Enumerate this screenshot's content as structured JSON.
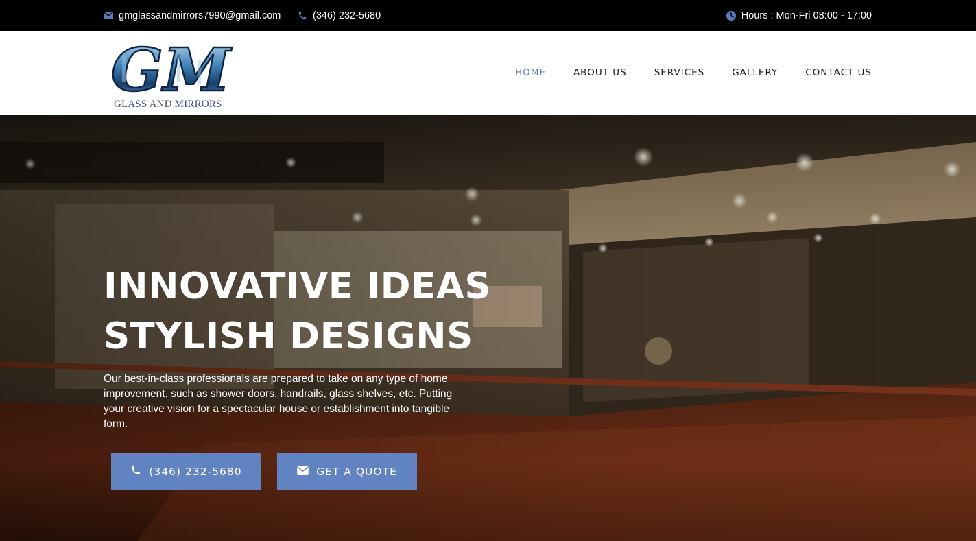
{
  "topbar": {
    "email": "gmglassandmirrors7990@gmail.com",
    "phone": "(346) 232-5680",
    "hours": "Hours : Mon-Fri 08:00 - 17:00",
    "icons": {
      "email": "envelope-icon",
      "phone": "phone-icon",
      "hours": "clock-icon"
    },
    "icon_color": "#5b7bb6"
  },
  "header": {
    "logo_letters": "GM",
    "logo_tagline": "GLASS AND MIRRORS",
    "nav": [
      {
        "label": "HOME",
        "active": true
      },
      {
        "label": "ABOUT US",
        "active": false
      },
      {
        "label": "SERVICES",
        "active": false
      },
      {
        "label": "GALLERY",
        "active": false
      },
      {
        "label": "CONTACT US",
        "active": false
      }
    ],
    "active_color": "#5b7bb6"
  },
  "hero": {
    "title_line1": "INNOVATIVE IDEAS",
    "title_line2": "STYLISH DESIGNS",
    "description": "Our best-in-class professionals are prepared to take on any type of home improvement, such as shower doors, handrails, glass shelves, etc. Putting your creative vision for a spectacular house or establishment into tangible form.",
    "buttons": {
      "call_label": "(346) 232-5680",
      "quote_label": "GET A QUOTE"
    },
    "button_color": "#6283c2"
  }
}
